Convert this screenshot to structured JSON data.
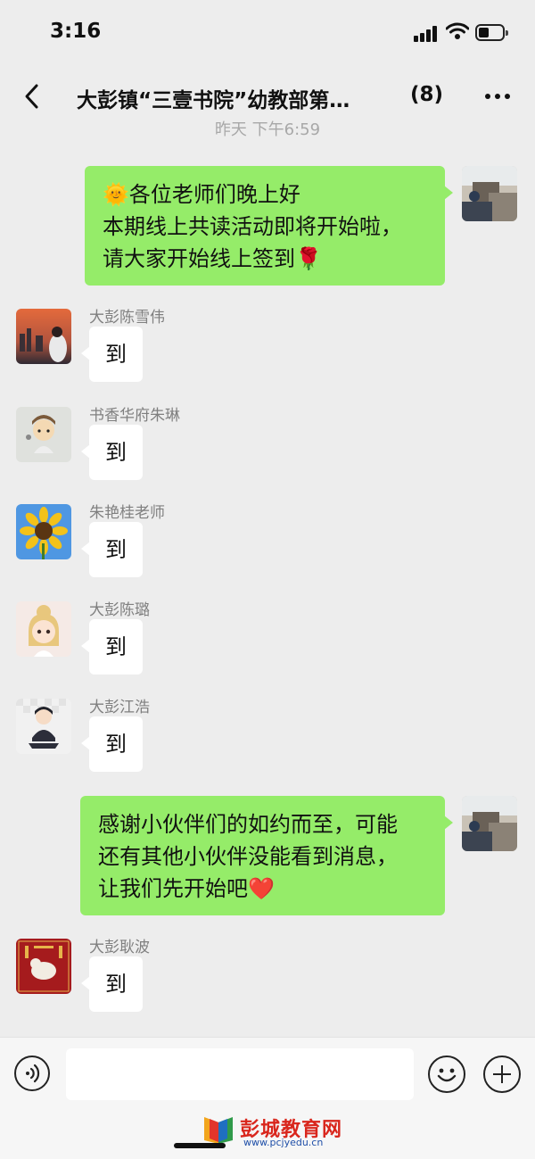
{
  "status_bar": {
    "time": "3:16"
  },
  "chat": {
    "title": "大彭镇“三壹书院”幼教部第…",
    "member_count": "(8)",
    "timestamp": "昨天 下午6:59"
  },
  "messages": [
    {
      "sender": "",
      "side": "out",
      "lines": [
        "🌞各位老师们晚上好",
        "本期线上共读活动即将开始啦，",
        "请大家开始线上签到🌹"
      ]
    },
    {
      "sender": "大彭陈雪伟",
      "side": "in",
      "text": "到"
    },
    {
      "sender": "书香华府朱琳",
      "side": "in",
      "text": "到"
    },
    {
      "sender": "朱艳桂老师",
      "side": "in",
      "text": "到"
    },
    {
      "sender": "大彭陈璐",
      "side": "in",
      "text": "到"
    },
    {
      "sender": "大彭江浩",
      "side": "in",
      "text": "到"
    },
    {
      "sender": "",
      "side": "out",
      "lines": [
        "感谢小伙伴们的如约而至，可能",
        "还有其他小伙伴没能看到消息，",
        "让我们先开始吧❤️"
      ]
    },
    {
      "sender": "大彭耿波",
      "side": "in",
      "text": "到"
    }
  ],
  "input": {
    "value": "",
    "placeholder": ""
  },
  "watermark": {
    "title": "彭城教育网",
    "url": "www.pcjyedu.cn"
  },
  "icons": {
    "back": "chevron-left-icon",
    "more": "more-dots-icon",
    "voice": "voice-icon",
    "emoji": "emoji-icon",
    "plus": "plus-icon"
  },
  "colors": {
    "outgoing_bubble": "#95ec69",
    "incoming_bubble": "#ffffff",
    "background": "#ededed"
  }
}
